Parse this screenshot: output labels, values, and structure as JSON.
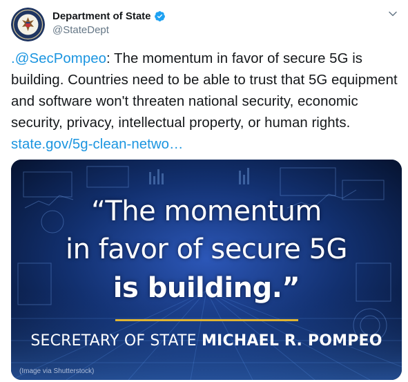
{
  "tweet": {
    "author": {
      "display_name": "Department of State",
      "handle": "@StateDept",
      "verified": true
    },
    "text": {
      "mention": ".@SecPompeo",
      "body": ": The momentum in favor of secure 5G is building. Countries need to be able to trust that 5G equipment and software won't threaten national security, economic security, privacy, intellectual property, or human rights. ",
      "link": "state.gov/5g-clean-netwo…"
    },
    "media": {
      "quote_line1": "“The momentum",
      "quote_line2": "in favor of secure 5G",
      "quote_line3": "is building.”",
      "byline_title": "SECRETARY OF STATE",
      "byline_name": "MICHAEL R. POMPEO",
      "credit": "(Image via Shutterstock)"
    }
  },
  "colors": {
    "link": "#1b95e0",
    "verified": "#1da1f2",
    "accent_rule": "#e0b431",
    "media_bg": "#0a1a45"
  },
  "icons": [
    "seal-avatar",
    "verified-badge-icon",
    "chevron-down-icon"
  ]
}
